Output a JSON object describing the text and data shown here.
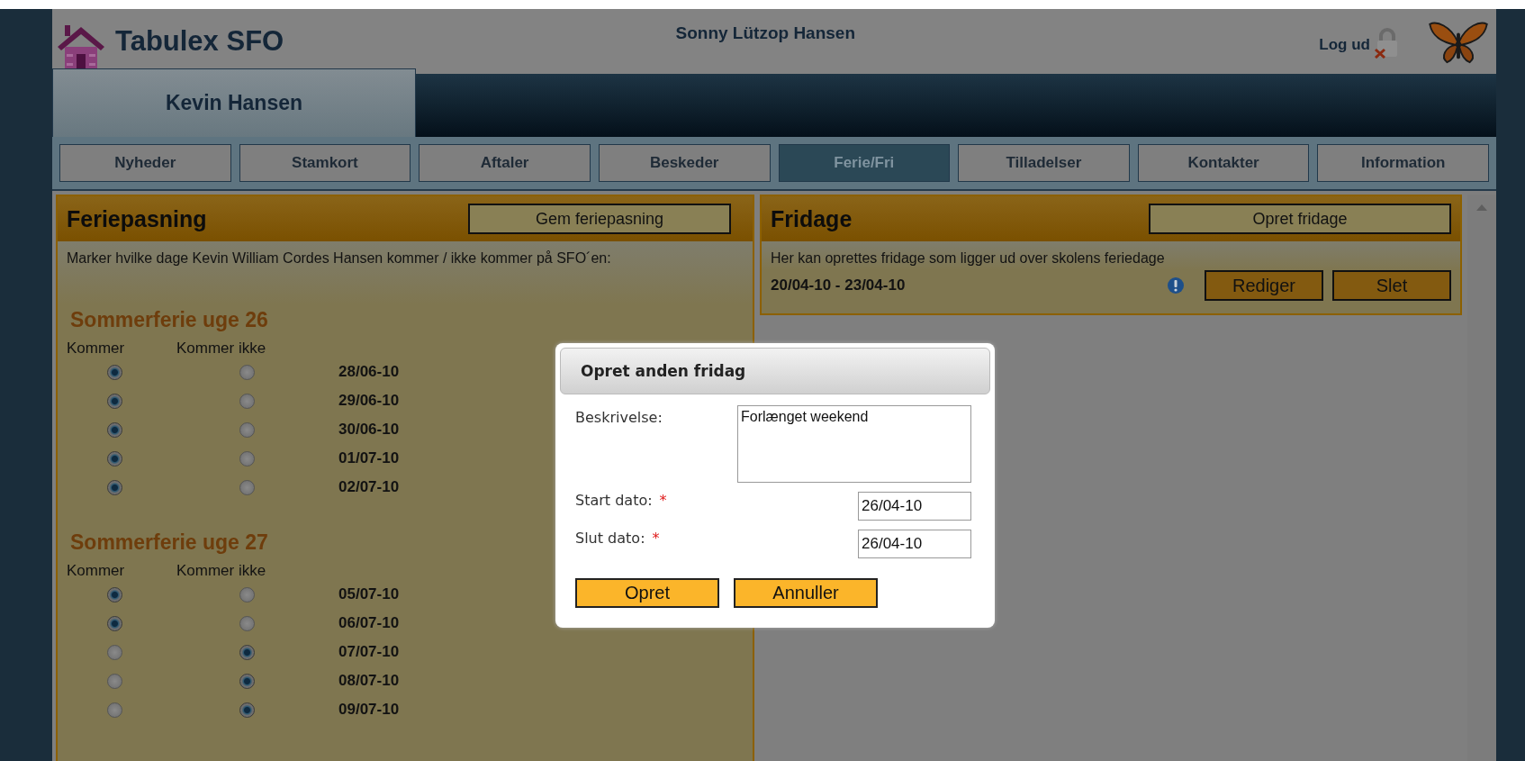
{
  "app": {
    "title": "Tabulex SFO",
    "user": "Sonny Lützop Hansen",
    "logout": "Log ud"
  },
  "child_tab": {
    "label": "Kevin Hansen"
  },
  "nav": [
    {
      "label": "Nyheder",
      "selected": false
    },
    {
      "label": "Stamkort",
      "selected": false
    },
    {
      "label": "Aftaler",
      "selected": false
    },
    {
      "label": "Beskeder",
      "selected": false
    },
    {
      "label": "Ferie/Fri",
      "selected": true
    },
    {
      "label": "Tilladelser",
      "selected": false
    },
    {
      "label": "Kontakter",
      "selected": false
    },
    {
      "label": "Information",
      "selected": false
    }
  ],
  "vacation_panel": {
    "title": "Feriepasning",
    "save_button": "Gem feriepasning",
    "instruction": "Marker hvilke dage Kevin William Cordes Hansen kommer / ikke kommer på SFO´en:",
    "sections": [
      {
        "heading": "Sommerferie uge 26",
        "col_attending": "Kommer",
        "col_absent": "Kommer ikke",
        "rows": [
          {
            "date": "28/06-10",
            "attending": true
          },
          {
            "date": "29/06-10",
            "attending": true
          },
          {
            "date": "30/06-10",
            "attending": true
          },
          {
            "date": "01/07-10",
            "attending": true
          },
          {
            "date": "02/07-10",
            "attending": true
          }
        ]
      },
      {
        "heading": "Sommerferie uge 27",
        "col_attending": "Kommer",
        "col_absent": "Kommer ikke",
        "rows": [
          {
            "date": "05/07-10",
            "attending": true
          },
          {
            "date": "06/07-10",
            "attending": true
          },
          {
            "date": "07/07-10",
            "attending": false
          },
          {
            "date": "08/07-10",
            "attending": false
          },
          {
            "date": "09/07-10",
            "attending": false
          }
        ]
      }
    ]
  },
  "days_off_panel": {
    "title": "Fridage",
    "create_button": "Opret fridage",
    "description": "Her kan oprettes fridage som ligger ud over skolens feriedage",
    "entries": [
      {
        "range": "20/04-10 - 23/04-10",
        "edit": "Rediger",
        "delete": "Slet"
      }
    ]
  },
  "dialog": {
    "title": "Opret anden fridag",
    "fields": [
      {
        "kind": "textarea",
        "label": "Beskrivelse:",
        "value": "Forlænget weekend"
      },
      {
        "kind": "text",
        "label": "Start dato:",
        "required_mark": "*",
        "value": "26/04-10"
      },
      {
        "kind": "text",
        "label": "Slut dato:",
        "required_mark": "*",
        "value": "26/04-10"
      }
    ],
    "buttons": [
      "Opret",
      "Annuller"
    ]
  }
}
